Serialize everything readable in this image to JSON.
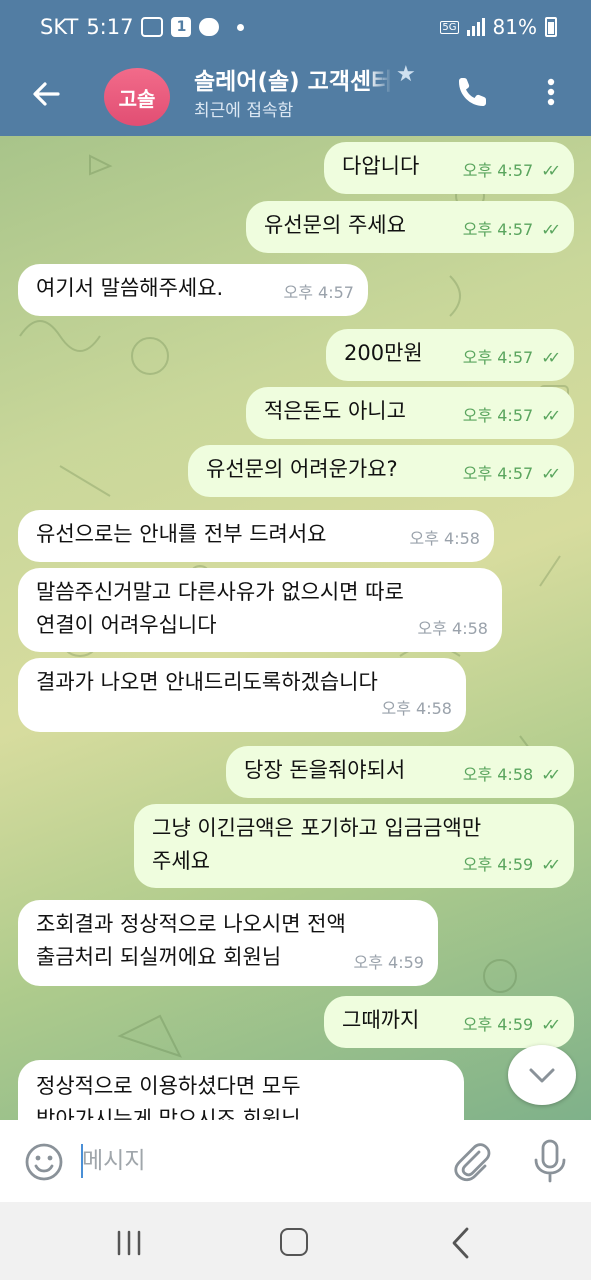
{
  "status_bar": {
    "carrier": "SKT",
    "time": "5:17",
    "notification_count": "1",
    "network": "5G",
    "battery": "81%"
  },
  "header": {
    "avatar_initials": "고솔",
    "title": "솔레어(솔) 고객센터",
    "status": "최근에 접속함"
  },
  "messages": [
    {
      "direction": "out",
      "text": "다압니다",
      "time": "오후 4:57",
      "read": true
    },
    {
      "direction": "out",
      "text": "유선문의 주세요",
      "time": "오후 4:57",
      "read": true
    },
    {
      "direction": "in",
      "text": "여기서 말씀해주세요.",
      "time": "오후 4:57"
    },
    {
      "direction": "out",
      "text": "200만원",
      "time": "오후 4:57",
      "read": true
    },
    {
      "direction": "out",
      "text": "적은돈도 아니고",
      "time": "오후 4:57",
      "read": true
    },
    {
      "direction": "out",
      "text": "유선문의 어려운가요?",
      "time": "오후 4:57",
      "read": true
    },
    {
      "direction": "in",
      "text": "유선으로는 안내를 전부 드려서요",
      "time": "오후 4:58"
    },
    {
      "direction": "in",
      "text": "말씀주신거말고 다른사유가 없으시면 따로\n연결이 어려우십니다",
      "time": "오후 4:58"
    },
    {
      "direction": "in",
      "text": "결과가 나오면 안내드리도록하겠습니다",
      "time": "오후 4:58"
    },
    {
      "direction": "out",
      "text": "당장 돈을줘야되서",
      "time": "오후 4:58",
      "read": true
    },
    {
      "direction": "out",
      "text": "그냥 이긴금액은 포기하고 입금금액만\n주세요",
      "time": "오후 4:59",
      "read": true
    },
    {
      "direction": "in",
      "text": "조회결과 정상적으로 나오시면 전액\n출금처리 되실꺼에요 회원님",
      "time": "오후 4:59"
    },
    {
      "direction": "out",
      "text": "그때까지",
      "time": "오후 4:59",
      "read": true
    },
    {
      "direction": "in",
      "text": "정상적으로 이용하셨다면 모두\n받아가시는게 맞으시죠 회원님",
      "time": ""
    }
  ],
  "input": {
    "placeholder": "메시지"
  },
  "icons": {
    "back": "back-arrow-icon",
    "call": "phone-icon",
    "more": "more-vertical-icon",
    "verified": "star-icon",
    "emoji": "emoji-icon",
    "attach": "paperclip-icon",
    "mic": "microphone-icon",
    "scroll_down": "chevron-down-icon"
  },
  "colors": {
    "header_bg": "#527da3",
    "outgoing_bubble": "#effdde",
    "incoming_bubble": "#ffffff",
    "time_green": "#5aa55e",
    "avatar": "#e8577a"
  }
}
